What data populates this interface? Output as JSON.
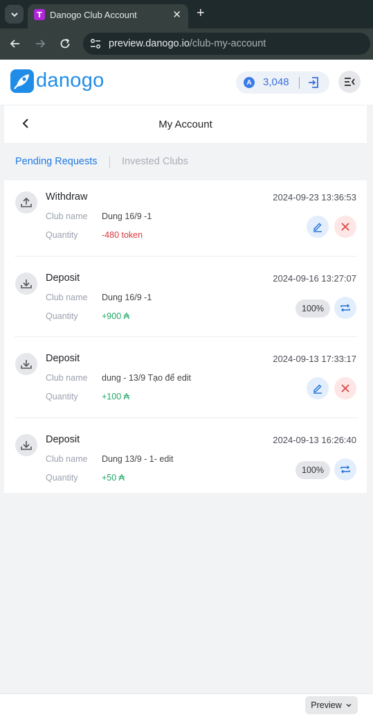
{
  "browser": {
    "tab_title": "Danogo Club Account",
    "tab_favicon_letter": "T",
    "url_host": "preview.danogo.io",
    "url_path": "/club-my-account"
  },
  "header": {
    "logo_text": "danogo",
    "token_symbol": "A",
    "token_balance": "3,048"
  },
  "page": {
    "title": "My Account"
  },
  "tabs": {
    "pending": "Pending Requests",
    "invested": "Invested Clubs",
    "active": "pending"
  },
  "labels": {
    "club_name": "Club name",
    "quantity": "Quantity"
  },
  "requests": [
    {
      "type": "Withdraw",
      "datetime": "2024-09-23 13:36:53",
      "club_name": "Dung 16/9 -1",
      "quantity": "-480 token",
      "quantity_sign": "negative",
      "status": "editable",
      "icon": "upload-icon"
    },
    {
      "type": "Deposit",
      "datetime": "2024-09-16 13:27:07",
      "club_name": "Dung 16/9 -1",
      "quantity": "+900 ₳",
      "quantity_sign": "positive",
      "status": "progress",
      "progress_text": "100%",
      "progress": 1.0,
      "icon": "download-icon"
    },
    {
      "type": "Deposit",
      "datetime": "2024-09-13 17:33:17",
      "club_name": "dung - 13/9 Tạo để edit",
      "quantity": "+100 ₳",
      "quantity_sign": "positive",
      "status": "editable",
      "icon": "download-icon"
    },
    {
      "type": "Deposit",
      "datetime": "2024-09-13 16:26:40",
      "club_name": "Dung 13/9 - 1- edit",
      "quantity": "+50 ₳",
      "quantity_sign": "positive",
      "status": "progress",
      "progress_text": "100%",
      "progress": 1.0,
      "icon": "download-icon"
    }
  ],
  "footer": {
    "preview_label": "Preview"
  },
  "colors": {
    "accent": "#1f7ae0",
    "negative": "#d9383b",
    "positive": "#1fa866"
  }
}
